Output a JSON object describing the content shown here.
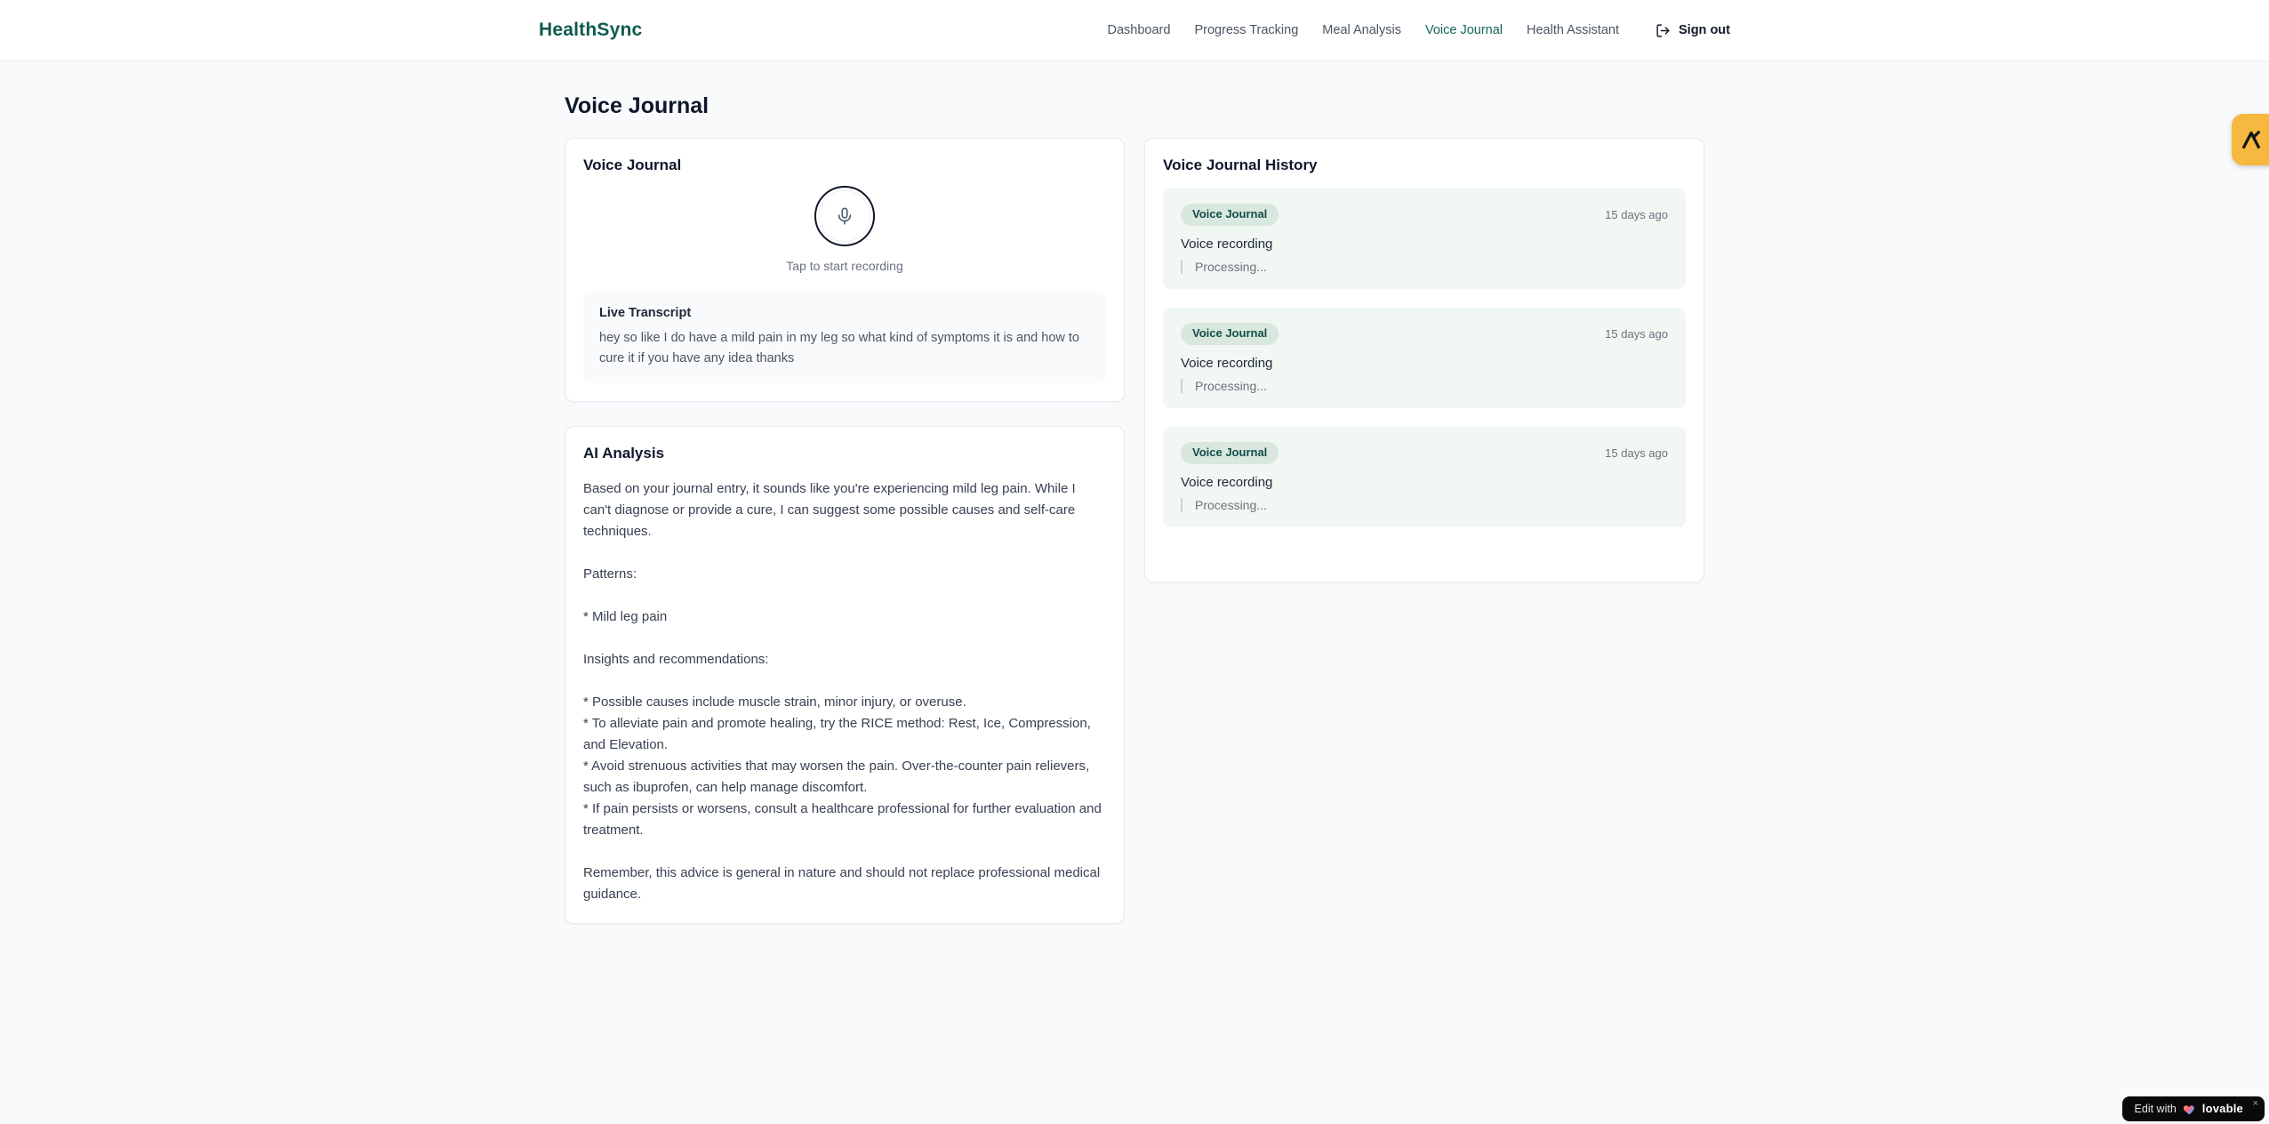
{
  "brand": {
    "name": "HealthSync",
    "color": "#0d5c4d"
  },
  "nav": {
    "items": [
      {
        "label": "Dashboard",
        "active": false
      },
      {
        "label": "Progress Tracking",
        "active": false
      },
      {
        "label": "Meal Analysis",
        "active": false
      },
      {
        "label": "Voice Journal",
        "active": true
      },
      {
        "label": "Health Assistant",
        "active": false
      }
    ],
    "sign_out_label": "Sign out",
    "sign_out_icon": "logout-icon"
  },
  "page": {
    "title": "Voice Journal",
    "background": "#f8fafc"
  },
  "recorder": {
    "card_title": "Voice Journal",
    "mic_icon": "microphone-icon",
    "tap_hint": "Tap to start recording",
    "transcript_title": "Live Transcript",
    "transcript_text": "hey so like I do have a mild pain in my leg so what kind of symptoms it is and how to cure it if you have any idea thanks"
  },
  "analysis": {
    "card_title": "AI Analysis",
    "body": "Based on your journal entry, it sounds like you're experiencing mild leg pain. While I can't diagnose or provide a cure, I can suggest some possible causes and self-care techniques.\n\nPatterns:\n\n* Mild leg pain\n\nInsights and recommendations:\n\n* Possible causes include muscle strain, minor injury, or overuse.\n* To alleviate pain and promote healing, try the RICE method: Rest, Ice, Compression, and Elevation.\n* Avoid strenuous activities that may worsen the pain. Over-the-counter pain relievers, such as ibuprofen, can help manage discomfort.\n* If pain persists or worsens, consult a healthcare professional for further evaluation and treatment.\n\nRemember, this advice is general in nature and should not replace professional medical guidance."
  },
  "history": {
    "card_title": "Voice Journal History",
    "entries": [
      {
        "badge": "Voice Journal",
        "time": "15 days ago",
        "title": "Voice recording",
        "status": "Processing..."
      },
      {
        "badge": "Voice Journal",
        "time": "15 days ago",
        "title": "Voice recording",
        "status": "Processing..."
      },
      {
        "badge": "Voice Journal",
        "time": "15 days ago",
        "title": "Voice recording",
        "status": "Processing..."
      }
    ],
    "badge_bg": "#d9e8df",
    "badge_color": "#134e48",
    "entry_bg": "#f1f7f2"
  },
  "overlays": {
    "side_launcher_color": "#f6b83e",
    "side_launcher_icon": "lovable-mark-icon",
    "edit_badge": {
      "prefix": "Edit with",
      "heart_icon": "gradient-heart-icon",
      "brand": "lovable",
      "close": "×"
    }
  }
}
